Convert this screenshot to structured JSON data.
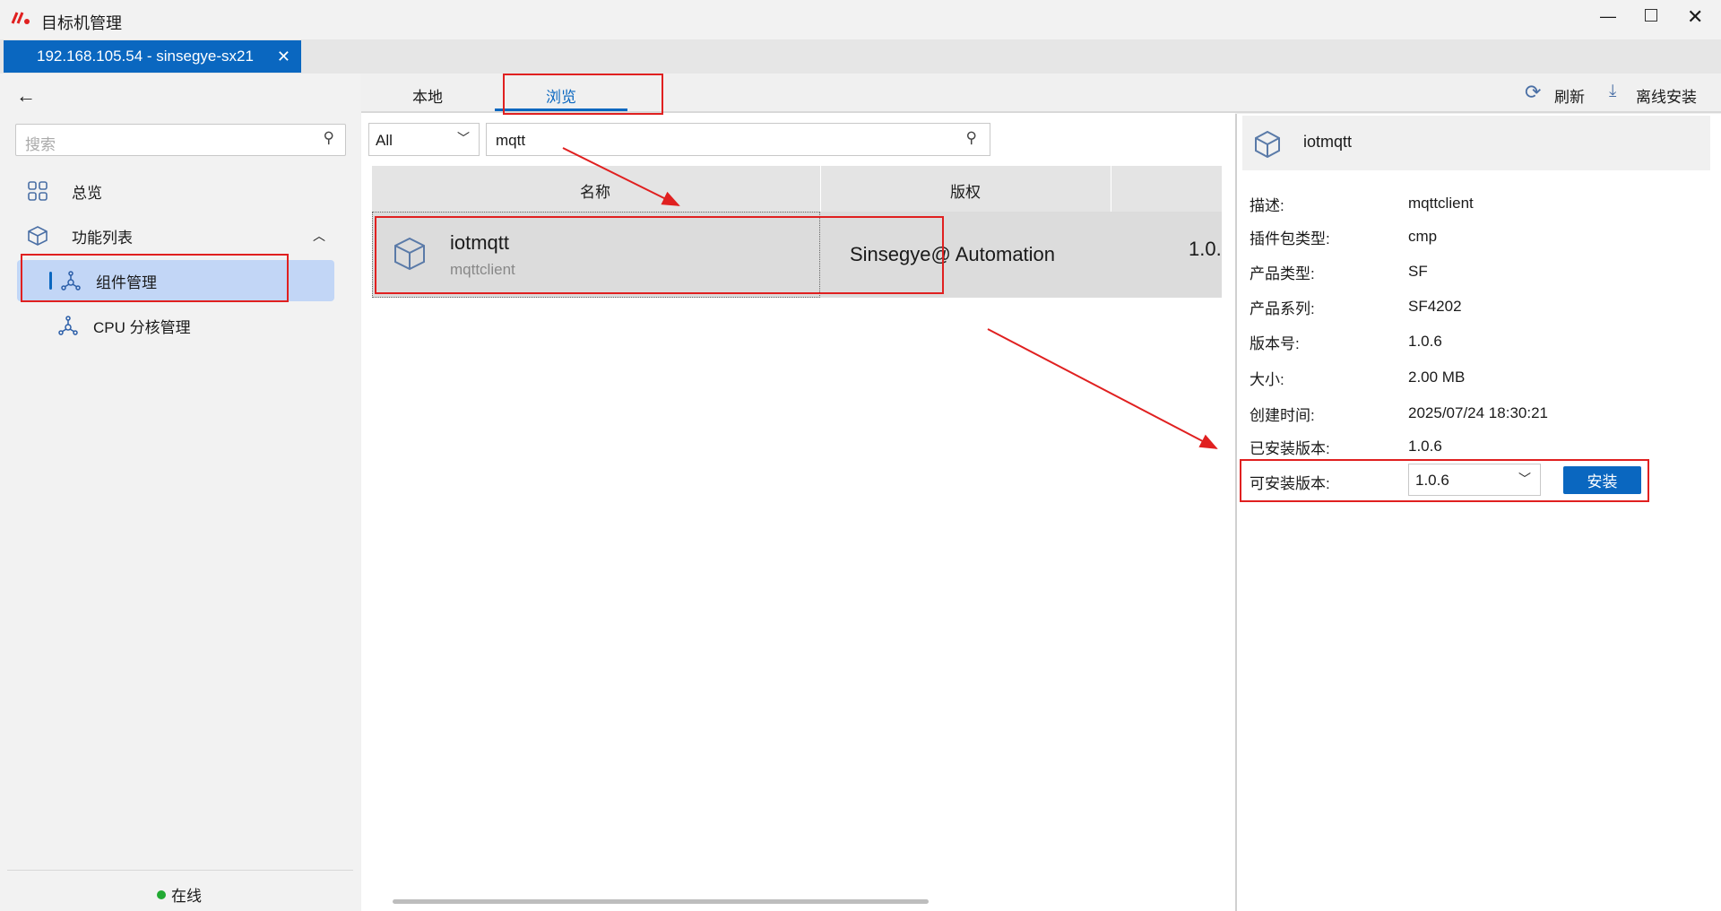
{
  "window": {
    "title": "目标机管理",
    "tab_label": "192.168.105.54  -  sinsegye-sx21"
  },
  "sidebar": {
    "search_placeholder": "搜索",
    "items": [
      {
        "label": "总览"
      },
      {
        "label": "功能列表"
      },
      {
        "label": "组件管理"
      },
      {
        "label": "CPU  分核管理"
      }
    ],
    "status": "在线",
    "status_color": "#22aa33"
  },
  "toolbar": {
    "tabs": [
      {
        "label": "本地"
      },
      {
        "label": "浏览"
      }
    ],
    "refresh": "刷新",
    "offline_install": "离线安装"
  },
  "filter": {
    "category": "All",
    "search_value": "mqtt"
  },
  "table": {
    "headers": [
      "名称",
      "版权"
    ],
    "rows": [
      {
        "name": "iotmqtt",
        "desc": "mqttclient",
        "copyright": "Sinsegye@  Automation",
        "version": "1.0."
      }
    ]
  },
  "details": {
    "title": "iotmqtt",
    "fields": [
      {
        "label": "描述:",
        "value": "mqttclient"
      },
      {
        "label": "插件包类型:",
        "value": "cmp"
      },
      {
        "label": "产品类型:",
        "value": "SF"
      },
      {
        "label": "产品系列:",
        "value": "SF4202"
      },
      {
        "label": "版本号:",
        "value": "1.0.6"
      },
      {
        "label": "大小:",
        "value": "2.00  MB"
      },
      {
        "label": "创建时间:",
        "value": "2025/07/24  18:30:21"
      },
      {
        "label": "已安装版本:",
        "value": "1.0.6"
      }
    ],
    "installable_label": "可安装版本:",
    "installable_value": "1.0.6",
    "install_button": "安装"
  },
  "colors": {
    "accent": "#0a67c0",
    "annotation": "#e02020"
  }
}
